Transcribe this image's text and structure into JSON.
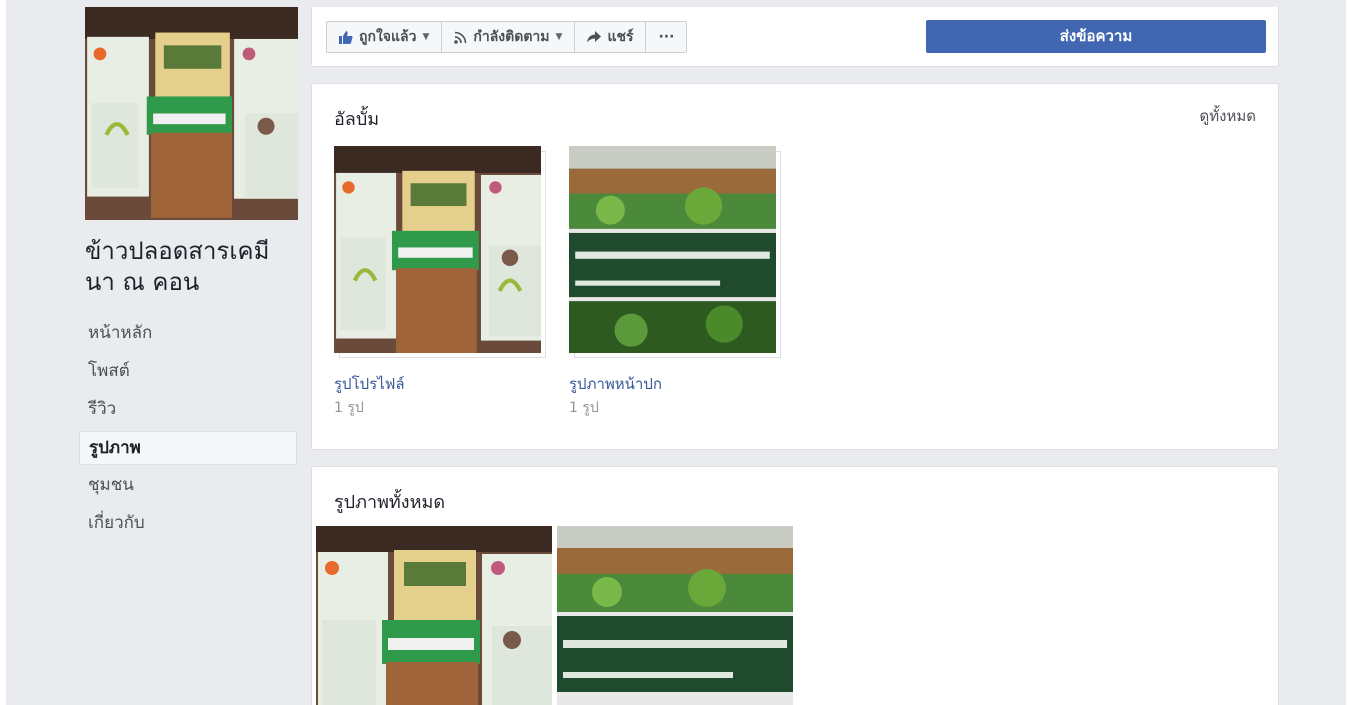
{
  "page": {
    "name": "ข้าวปลอดสารเคมี นา ณ คอน"
  },
  "sidebar": {
    "items": [
      {
        "label": "หน้าหลัก"
      },
      {
        "label": "โพสต์"
      },
      {
        "label": "รีวิว"
      },
      {
        "label": "รูปภาพ",
        "active": true
      },
      {
        "label": "ชุมชน"
      },
      {
        "label": "เกี่ยวกับ"
      }
    ]
  },
  "actions": {
    "like_label": "ถูกใจแล้ว",
    "follow_label": "กำลังติดตาม",
    "share_label": "แชร์",
    "more_label": "···",
    "message_label": "ส่งข้อความ"
  },
  "albums": {
    "title": "อัลบั้ม",
    "see_all": "ดูทั้งหมด",
    "items": [
      {
        "name": "รูปโปรไฟล์",
        "count": "1 รูป",
        "image": "rice-products-photo"
      },
      {
        "name": "รูปภาพหน้าปก",
        "count": "1 รูป",
        "image": "community-sign-photo"
      }
    ]
  },
  "all_photos": {
    "title": "รูปภาพทั้งหมด",
    "items": [
      {
        "image": "rice-products-photo"
      },
      {
        "image": "community-sign-photo"
      }
    ]
  },
  "colors": {
    "accent": "#4267b2",
    "link": "#385898",
    "page_bg": "#e9ebee"
  }
}
